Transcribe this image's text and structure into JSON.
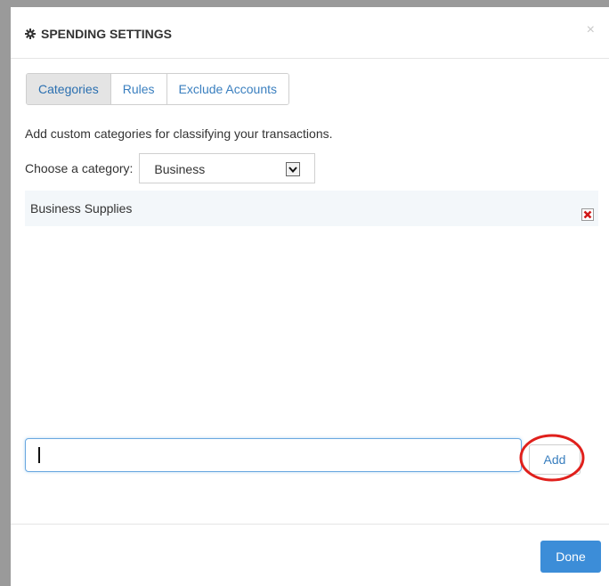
{
  "modal": {
    "title": "SPENDING SETTINGS",
    "close_symbol": "×",
    "header_icon": "gear-icon"
  },
  "tabs": [
    {
      "label": "Categories",
      "active": true
    },
    {
      "label": "Rules",
      "active": false
    },
    {
      "label": "Exclude Accounts",
      "active": false
    }
  ],
  "content": {
    "description": "Add custom categories for classifying your transactions.",
    "choose_label": "Choose a category:",
    "selected_category": "Business",
    "items": [
      {
        "label": "Business Supplies"
      }
    ]
  },
  "add_form": {
    "input_value": "",
    "add_label": "Add"
  },
  "footer": {
    "done_label": "Done"
  },
  "colors": {
    "accent": "#3c8dd8",
    "link": "#3a7fbf",
    "highlight_circle": "#e0201c",
    "remove_icon": "#d01818"
  }
}
